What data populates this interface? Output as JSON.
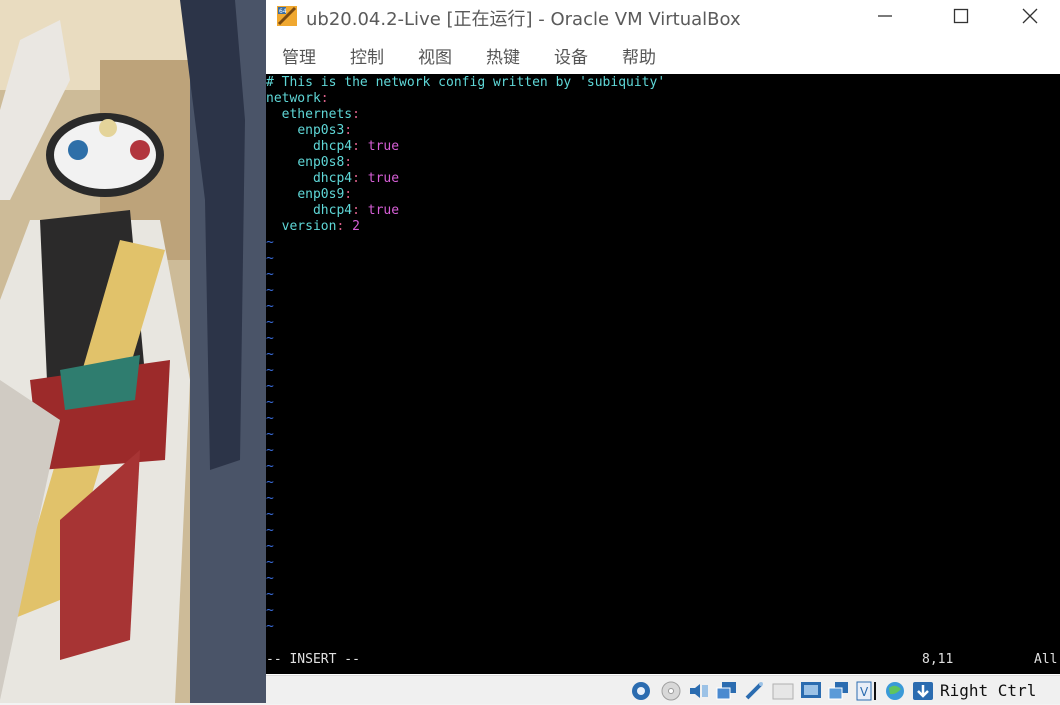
{
  "window": {
    "title": "ub20.04.2-Live [正在运行] - Oracle VM VirtualBox"
  },
  "menu": {
    "items": [
      {
        "label": "管理"
      },
      {
        "label": "控制"
      },
      {
        "label": "视图"
      },
      {
        "label": "热键"
      },
      {
        "label": "设备"
      },
      {
        "label": "帮助"
      }
    ]
  },
  "terminal": {
    "comment_line": "# This is the network config written by 'subiquity'",
    "lines": [
      {
        "indent": "",
        "key": "network",
        "value": ""
      },
      {
        "indent": "  ",
        "key": "ethernets",
        "value": ""
      },
      {
        "indent": "    ",
        "key": "enp0s3",
        "value": ""
      },
      {
        "indent": "      ",
        "key": "dhcp4",
        "value": "true"
      },
      {
        "indent": "    ",
        "key": "enp0s8",
        "value": ""
      },
      {
        "indent": "      ",
        "key": "dhcp4",
        "value": "true"
      },
      {
        "indent": "    ",
        "key": "enp0s9",
        "value": ""
      },
      {
        "indent": "      ",
        "key": "dhcp4",
        "value": "true"
      },
      {
        "indent": "  ",
        "key": "version",
        "value": "2"
      }
    ],
    "empty_line_marker": "~",
    "mode": "-- INSERT --",
    "cursor_position": "8,11",
    "scroll_position": "All",
    "colors": {
      "background": "#000000",
      "key": "#5fd7d7",
      "colon": "#d75f87",
      "value": "#d75fd7",
      "tilde": "#3a6ee0"
    }
  },
  "statusbar": {
    "icons": [
      "hard-disk-icon",
      "optical-drive-icon",
      "audio-icon",
      "network-icon",
      "usb-icon",
      "shared-folders-icon",
      "display-icon",
      "recording-icon",
      "virtualization-icon",
      "mouse-integration-icon",
      "keyboard-icon"
    ],
    "host_key": "Right Ctrl"
  }
}
